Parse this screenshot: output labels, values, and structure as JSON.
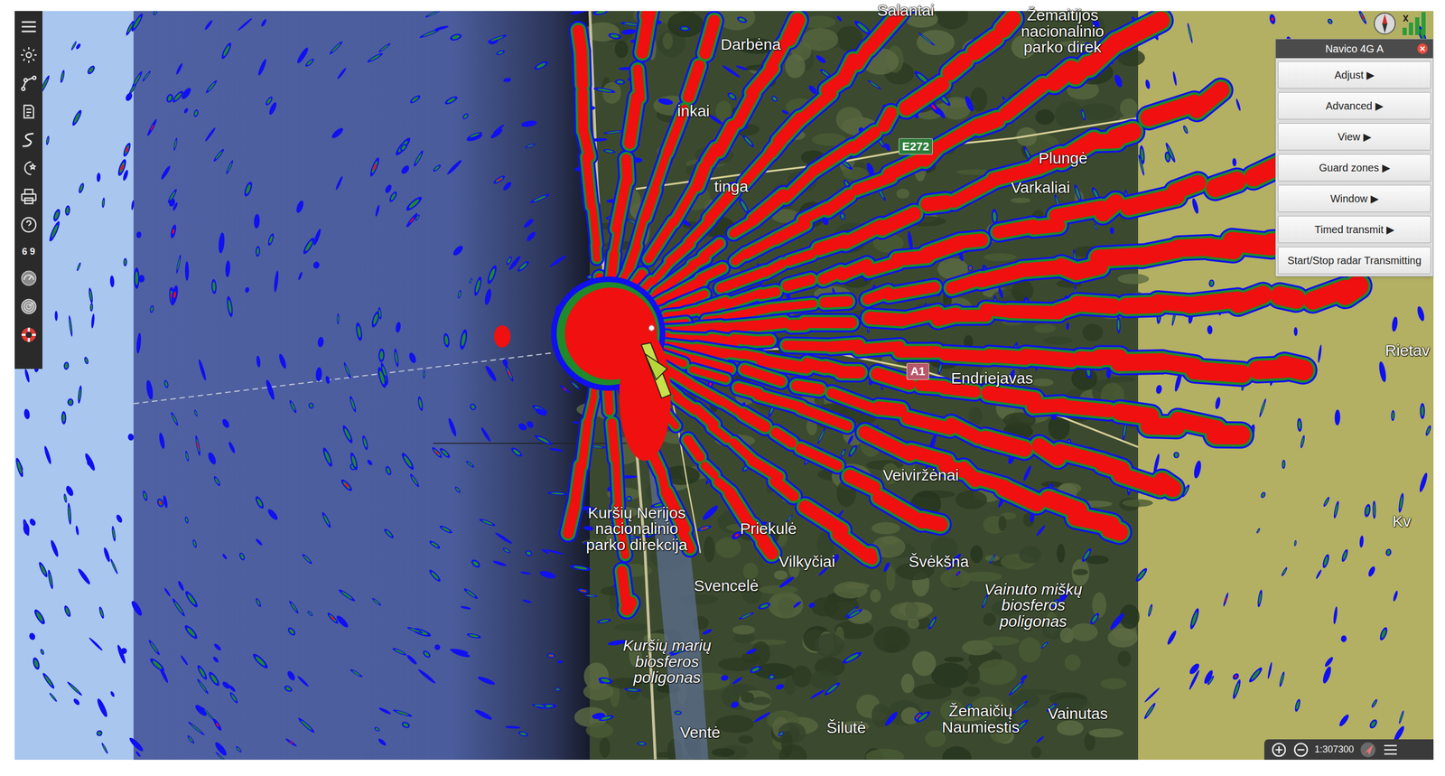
{
  "toolbar": {
    "badge": "6 9"
  },
  "radar_panel": {
    "title": "Navico 4G A",
    "buttons": [
      {
        "label": "Adjust ▶"
      },
      {
        "label": "Advanced ▶"
      },
      {
        "label": "View ▶"
      },
      {
        "label": "Guard zones ▶"
      },
      {
        "label": "Window ▶"
      },
      {
        "label": "Timed transmit ▶"
      },
      {
        "label": "Start/Stop radar Transmitting"
      }
    ]
  },
  "map": {
    "labels": [
      {
        "lines": [
          "Salantai"
        ],
        "kind": "place"
      },
      {
        "lines": [
          "Žemaitijos",
          "nacionalinio",
          "parko direk"
        ],
        "kind": "place"
      },
      {
        "lines": [
          "Darbėna"
        ],
        "kind": "place"
      },
      {
        "lines": [
          "inkai"
        ],
        "kind": "place"
      },
      {
        "lines": [
          "tinga"
        ],
        "kind": "place"
      },
      {
        "lines": [
          "Plungė"
        ],
        "kind": "place"
      },
      {
        "lines": [
          "Varkaliai"
        ],
        "kind": "place"
      },
      {
        "lines": [
          "Rietav"
        ],
        "kind": "place"
      },
      {
        "lines": [
          "Endriejavas"
        ],
        "kind": "place"
      },
      {
        "lines": [
          "Veiviržėnai"
        ],
        "kind": "place"
      },
      {
        "lines": [
          "Kv"
        ],
        "kind": "place"
      },
      {
        "lines": [
          "Kuršių Nerijos",
          "nacionalinio",
          "parko direkcija"
        ],
        "kind": "place"
      },
      {
        "lines": [
          "Priekulė"
        ],
        "kind": "place"
      },
      {
        "lines": [
          "Vilkyčiai"
        ],
        "kind": "place"
      },
      {
        "lines": [
          "Švėkšna"
        ],
        "kind": "place"
      },
      {
        "lines": [
          "Svencelė"
        ],
        "kind": "place"
      },
      {
        "lines": [
          "Vainuto miškų",
          "biosferos",
          "poligonas"
        ],
        "kind": "zone"
      },
      {
        "lines": [
          "Kuršių marių",
          "biosferos",
          "poligonas"
        ],
        "kind": "zone"
      },
      {
        "lines": [
          "Ventė"
        ],
        "kind": "place"
      },
      {
        "lines": [
          "Šilutė"
        ],
        "kind": "place"
      },
      {
        "lines": [
          "Žemaičių",
          "Naumiestis"
        ],
        "kind": "place"
      },
      {
        "lines": [
          "Vainutas"
        ],
        "kind": "place"
      }
    ],
    "road_shields": [
      {
        "label": "E272",
        "color": "#2f7d3a"
      },
      {
        "label": "A1",
        "color": "#b8576a"
      }
    ]
  },
  "zoom_bar": {
    "scale": "1:307300"
  }
}
